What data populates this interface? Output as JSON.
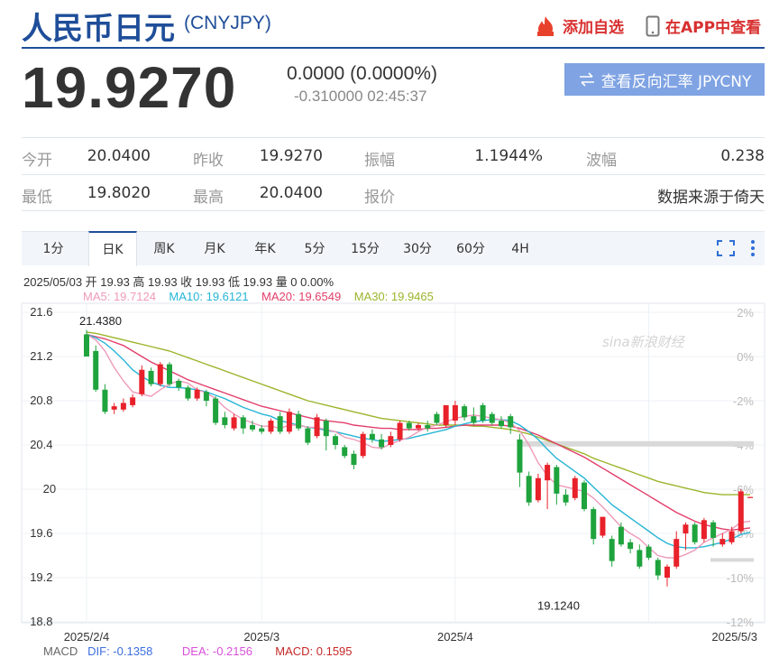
{
  "header": {
    "title": "人民币日元",
    "code": "(CNYJPY)",
    "add_watchlist": "添加自选",
    "view_in_app": "在APP中查看"
  },
  "quote": {
    "price": "19.9270",
    "change": "0.0000 (0.0000%)",
    "sub": "-0.310000 02:45:37",
    "reverse_button": "查看反向汇率 JPYCNY"
  },
  "stats": [
    [
      {
        "label": "今开",
        "value": "20.0400"
      },
      {
        "label": "昨收",
        "value": "19.9270"
      },
      {
        "label": "振幅",
        "value": "1.1944%"
      },
      {
        "label": "波幅",
        "value": "0.238"
      }
    ],
    [
      {
        "label": "最低",
        "value": "19.8020"
      },
      {
        "label": "最高",
        "value": "20.0400"
      },
      {
        "label": "报价",
        "value": "数据来源于倚天"
      }
    ]
  ],
  "tabs": [
    "1分",
    "日K",
    "周K",
    "月K",
    "年K",
    "5分",
    "15分",
    "30分",
    "60分",
    "4H"
  ],
  "active_tab": 1,
  "ohlc_line": "2025/05/03 开 19.93 高 19.93 收 19.93 低 19.93 量 0 0.00%",
  "ma_legend": {
    "ma5": "MA5: 19.7124",
    "ma10": "MA10: 19.6121",
    "ma20": "MA20: 19.6549",
    "ma30": "MA30: 19.9465"
  },
  "macd_legend": {
    "label": "MACD",
    "dif": "DIF: -0.1358",
    "dea": "DEA: -0.2156",
    "macd": "MACD: 0.1595"
  },
  "colors": {
    "up": "#e8212a",
    "down": "#1ea33d",
    "ma5": "#ee9aba",
    "ma10": "#26b5d6",
    "ma20": "#e23e6b",
    "ma30": "#9bb52c",
    "brand": "#1f4e99"
  },
  "chart_data": {
    "type": "candlestick",
    "yticks": [
      "21.6",
      "21.2",
      "20.8",
      "20.4",
      "20",
      "19.6",
      "19.2",
      "18.8"
    ],
    "yvalues": [
      21.6,
      21.2,
      20.8,
      20.4,
      20.0,
      19.6,
      19.2,
      18.8
    ],
    "pct_ticks": [
      "2%",
      "0%",
      "-2%",
      "-4%",
      "-6%",
      "-8%",
      "-10%",
      "-12%"
    ],
    "xticks": [
      "2025/2/4",
      "2025/3",
      "2025/4",
      "2025/5/3"
    ],
    "xtick_index": [
      0,
      19,
      40,
      61
    ],
    "ylim": [
      18.8,
      21.6
    ],
    "max_label": "21.4380",
    "max_index": 0,
    "min_label": "19.1240",
    "min_index": 54,
    "watermark": "sina新浪财经",
    "candles": [
      [
        21.4,
        21.2,
        21.44,
        21.22
      ],
      [
        21.25,
        20.9,
        21.3,
        20.88
      ],
      [
        20.9,
        20.7,
        20.95,
        20.68
      ],
      [
        20.72,
        20.75,
        20.78,
        20.68
      ],
      [
        20.72,
        20.78,
        20.82,
        20.7
      ],
      [
        20.76,
        20.83,
        20.86,
        20.74
      ],
      [
        20.86,
        21.08,
        21.12,
        20.84
      ],
      [
        21.07,
        20.95,
        21.1,
        20.93
      ],
      [
        20.95,
        21.13,
        21.15,
        20.93
      ],
      [
        21.13,
        20.95,
        21.15,
        20.93
      ],
      [
        20.98,
        20.92,
        21.0,
        20.89
      ],
      [
        20.92,
        20.82,
        20.94,
        20.8
      ],
      [
        20.82,
        20.9,
        20.92,
        20.8
      ],
      [
        20.88,
        20.8,
        20.9,
        20.75
      ],
      [
        20.82,
        20.6,
        20.84,
        20.58
      ],
      [
        20.65,
        20.58,
        20.7,
        20.55
      ],
      [
        20.55,
        20.65,
        20.68,
        20.53
      ],
      [
        20.65,
        20.55,
        20.67,
        20.5
      ],
      [
        20.58,
        20.54,
        20.62,
        20.52
      ],
      [
        20.55,
        20.52,
        20.58,
        20.5
      ],
      [
        20.52,
        20.62,
        20.64,
        20.5
      ],
      [
        20.66,
        20.52,
        20.7,
        20.5
      ],
      [
        20.52,
        20.7,
        20.73,
        20.5
      ],
      [
        20.68,
        20.55,
        20.71,
        20.53
      ],
      [
        20.55,
        20.42,
        20.57,
        20.4
      ],
      [
        20.48,
        20.65,
        20.68,
        20.46
      ],
      [
        20.62,
        20.48,
        20.64,
        20.35
      ],
      [
        20.48,
        20.4,
        20.5,
        20.36
      ],
      [
        20.38,
        20.3,
        20.4,
        20.28
      ],
      [
        20.32,
        20.22,
        20.35,
        20.18
      ],
      [
        20.3,
        20.5,
        20.52,
        20.28
      ],
      [
        20.5,
        20.45,
        20.54,
        20.42
      ],
      [
        20.45,
        20.38,
        20.5,
        20.36
      ],
      [
        20.4,
        20.48,
        20.52,
        20.38
      ],
      [
        20.45,
        20.6,
        20.62,
        20.43
      ],
      [
        20.6,
        20.55,
        20.62,
        20.53
      ],
      [
        20.55,
        20.58,
        20.6,
        20.53
      ],
      [
        20.58,
        20.55,
        20.62,
        20.52
      ],
      [
        20.68,
        20.6,
        20.7,
        20.58
      ],
      [
        20.58,
        20.76,
        20.72,
        20.56
      ],
      [
        20.62,
        20.76,
        20.8,
        20.58
      ],
      [
        20.75,
        20.65,
        20.77,
        20.62
      ],
      [
        20.66,
        20.6,
        20.74,
        20.58
      ],
      [
        20.76,
        20.62,
        20.78,
        20.6
      ],
      [
        20.68,
        20.6,
        20.7,
        20.58
      ],
      [
        20.62,
        20.57,
        20.66,
        20.55
      ],
      [
        20.66,
        20.56,
        20.68,
        20.5
      ],
      [
        20.45,
        20.15,
        20.5,
        20.02
      ],
      [
        20.12,
        19.88,
        20.16,
        19.85
      ],
      [
        19.9,
        20.1,
        20.14,
        19.88
      ],
      [
        20.08,
        20.22,
        20.24,
        19.82
      ],
      [
        20.2,
        19.96,
        20.22,
        19.86
      ],
      [
        19.95,
        19.88,
        20.0,
        19.85
      ],
      [
        19.92,
        20.1,
        20.12,
        19.9
      ],
      [
        20.06,
        19.82,
        20.08,
        19.8
      ],
      [
        19.82,
        19.55,
        19.84,
        19.5
      ],
      [
        19.58,
        19.75,
        19.75,
        19.56
      ],
      [
        19.55,
        19.35,
        19.58,
        19.3
      ],
      [
        19.66,
        19.5,
        19.7,
        19.48
      ],
      [
        19.52,
        19.46,
        19.55,
        19.42
      ],
      [
        19.45,
        19.3,
        19.5,
        19.28
      ],
      [
        19.48,
        19.38,
        19.5,
        19.36
      ],
      [
        19.36,
        19.22,
        19.38,
        19.18
      ],
      [
        19.2,
        19.3,
        19.32,
        19.12
      ],
      [
        19.3,
        19.55,
        19.62,
        19.28
      ],
      [
        19.6,
        19.68,
        19.7,
        19.45
      ],
      [
        19.68,
        19.52,
        19.7,
        19.5
      ],
      [
        19.55,
        19.72,
        19.74,
        19.52
      ],
      [
        19.7,
        19.56,
        19.72,
        19.48
      ],
      [
        19.5,
        19.55,
        19.6,
        19.48
      ],
      [
        19.52,
        19.62,
        19.66,
        19.5
      ],
      [
        19.62,
        19.98,
        20.0,
        19.6
      ],
      [
        19.92,
        19.93,
        19.93,
        19.92
      ]
    ],
    "ma5": [
      21.4,
      21.35,
      21.25,
      21.1,
      20.98,
      20.88,
      20.86,
      20.84,
      20.9,
      20.95,
      20.98,
      20.96,
      20.9,
      20.87,
      20.82,
      20.74,
      20.68,
      20.63,
      20.6,
      20.57,
      20.57,
      20.55,
      20.58,
      20.58,
      20.56,
      20.56,
      20.54,
      20.52,
      20.47,
      20.45,
      20.42,
      20.38,
      20.37,
      20.41,
      20.44,
      20.47,
      20.52,
      20.56,
      20.58,
      20.61,
      20.64,
      20.66,
      20.67,
      20.66,
      20.64,
      20.63,
      20.6,
      20.53,
      20.4,
      20.24,
      20.12,
      20.04,
      20.02,
      20.0,
      19.98,
      19.92,
      19.84,
      19.75,
      19.66,
      19.6,
      19.55,
      19.47,
      19.4,
      19.38,
      19.38,
      19.41,
      19.45,
      19.52,
      19.56,
      19.6,
      19.64,
      19.7,
      19.71
    ],
    "ma10": [
      21.4,
      21.37,
      21.32,
      21.25,
      21.17,
      21.08,
      21.02,
      20.97,
      20.94,
      20.92,
      20.92,
      20.91,
      20.9,
      20.88,
      20.85,
      20.82,
      20.78,
      20.74,
      20.71,
      20.68,
      20.66,
      20.62,
      20.6,
      20.58,
      20.56,
      20.55,
      20.53,
      20.52,
      20.5,
      20.48,
      20.46,
      20.45,
      20.43,
      20.44,
      20.45,
      20.46,
      20.48,
      20.5,
      20.52,
      20.54,
      20.57,
      20.59,
      20.61,
      20.62,
      20.63,
      20.63,
      20.62,
      20.58,
      20.52,
      20.45,
      20.36,
      20.28,
      20.22,
      20.16,
      20.1,
      20.02,
      19.94,
      19.86,
      19.8,
      19.74,
      19.68,
      19.62,
      19.56,
      19.51,
      19.48,
      19.47,
      19.47,
      19.48,
      19.5,
      19.52,
      19.55,
      19.59,
      19.61
    ],
    "ma20": [
      21.4,
      21.38,
      21.36,
      21.33,
      21.3,
      21.25,
      21.2,
      21.15,
      21.11,
      21.07,
      21.03,
      20.99,
      20.96,
      20.93,
      20.9,
      20.87,
      20.84,
      20.81,
      20.78,
      20.75,
      20.73,
      20.71,
      20.69,
      20.67,
      20.65,
      20.63,
      20.62,
      20.61,
      20.6,
      20.58,
      20.57,
      20.56,
      20.55,
      20.55,
      20.54,
      20.54,
      20.54,
      20.55,
      20.55,
      20.56,
      20.57,
      20.58,
      20.58,
      20.58,
      20.58,
      20.58,
      20.57,
      20.55,
      20.52,
      20.49,
      20.45,
      20.41,
      20.37,
      20.33,
      20.29,
      20.24,
      20.19,
      20.14,
      20.09,
      20.04,
      19.99,
      19.94,
      19.89,
      19.84,
      19.79,
      19.75,
      19.71,
      19.68,
      19.66,
      19.64,
      19.63,
      19.64,
      19.65
    ],
    "ma30": [
      21.42,
      21.41,
      21.39,
      21.37,
      21.35,
      21.33,
      21.31,
      21.29,
      21.27,
      21.25,
      21.22,
      21.19,
      21.16,
      21.13,
      21.1,
      21.07,
      21.04,
      21.01,
      20.98,
      20.95,
      20.92,
      20.89,
      20.86,
      20.83,
      20.8,
      20.78,
      20.76,
      20.74,
      20.72,
      20.7,
      20.68,
      20.66,
      20.64,
      20.63,
      20.62,
      20.61,
      20.6,
      20.59,
      20.58,
      20.58,
      20.58,
      20.58,
      20.57,
      20.57,
      20.56,
      20.55,
      20.54,
      20.52,
      20.5,
      20.47,
      20.44,
      20.41,
      20.38,
      20.35,
      20.32,
      20.28,
      20.25,
      20.22,
      20.19,
      20.16,
      20.13,
      20.1,
      20.07,
      20.05,
      20.03,
      20.01,
      19.99,
      19.97,
      19.96,
      19.95,
      19.95,
      19.95,
      19.95
    ]
  }
}
